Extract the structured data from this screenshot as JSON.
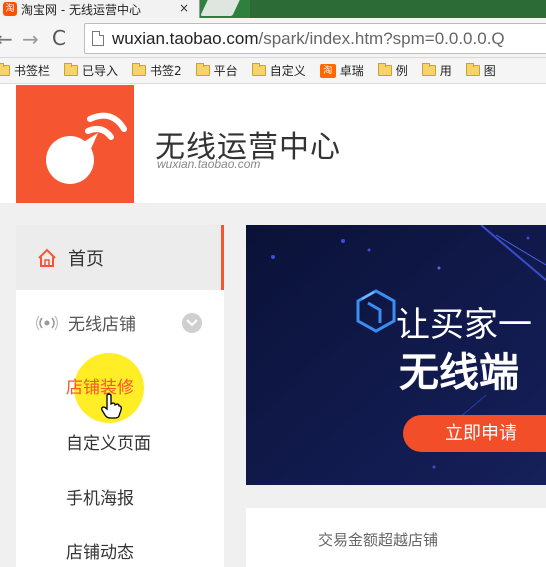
{
  "browser": {
    "tab_title": "淘宝网 - 无线运营中心",
    "tab_favicon_text": "淘",
    "tab_close": "×",
    "nav_back": "←",
    "nav_forward": "→",
    "nav_reload": "C",
    "url_host": "wuxian.taobao.com",
    "url_path": "/spark/index.htm?spm=0.0.0.0.Q",
    "bookmarks": [
      {
        "label": "书签栏",
        "icon": "folder-icon"
      },
      {
        "label": "已导入",
        "icon": "folder-icon"
      },
      {
        "label": "书签2",
        "icon": "folder-icon"
      },
      {
        "label": "平台",
        "icon": "folder-icon"
      },
      {
        "label": "自定义",
        "icon": "folder-icon"
      },
      {
        "label": "卓瑞",
        "icon": "taobao-icon",
        "icon_text": "淘"
      },
      {
        "label": "例",
        "icon": "folder-icon"
      },
      {
        "label": "用",
        "icon": "folder-icon"
      },
      {
        "label": "图",
        "icon": "folder-icon"
      }
    ]
  },
  "header": {
    "title": "无线运营中心",
    "subtitle": "wuxian.taobao.com"
  },
  "sidebar": {
    "home_label": "首页",
    "store_label": "无线店铺",
    "sub_items": [
      "店铺装修",
      "自定义页面",
      "手机海报",
      "店铺动态"
    ]
  },
  "banner": {
    "line1": "让买家一",
    "line2": "无线端",
    "button": "立即申请"
  },
  "card": {
    "text": "交易金额超越店铺"
  },
  "colors": {
    "brand": "#f55531",
    "banner_bg": "#0c1746",
    "button": "#f24e2a",
    "tabbar": "#2f7f3f"
  }
}
